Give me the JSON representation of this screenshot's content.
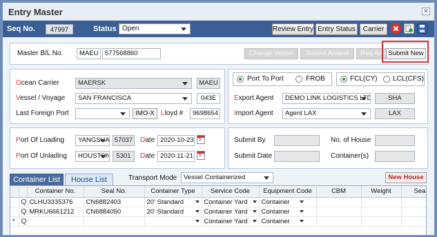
{
  "window": {
    "title": "Entry Master",
    "close_glyph": "✕"
  },
  "toolbar": {
    "seq_label": "Seq No.",
    "seq_value": "47997",
    "status_label": "Status",
    "status_value": "Open",
    "review_entry": "Review Entry",
    "entry_status": "Entry Status",
    "carrier": "Carrier"
  },
  "header": {
    "mbl_label": "Master B/L No.",
    "mbl_prefix": "MAEU",
    "mbl_value": "577568860",
    "change_vessel": "Change Vessel",
    "submit_amend": "Submit Amend",
    "req_amend": "Req Amend",
    "submit_new": "Submit New"
  },
  "carrier_section": {
    "ocean_carrier_hk": "O",
    "ocean_carrier_label": "cean Carrier",
    "ocean_carrier_value": "MAERSK",
    "ocean_carrier_code": "MAEU",
    "vessel_hk": "V",
    "vessel_label": "essel / Voyage",
    "vessel_value": "SAN FRANCISCA",
    "voyage_value": "043E",
    "last_port_label": "Last Foreign Port",
    "last_port_value": "",
    "imo_button": "IMO-X",
    "lloyd_hk": "L",
    "lloyd_label": "loyd #",
    "lloyd_value": "9698654"
  },
  "options": {
    "port_to_port": "Port To Port",
    "frob": "FROB",
    "fcl": "FCL(CY)",
    "lcl": "LCL(CFS)"
  },
  "agents": {
    "export_hk": "E",
    "export_label": "xport Agent",
    "export_value": "DEMO LINK LOGISTICS LTD.",
    "export_code": "SHA",
    "import_hk": "I",
    "import_label": "mport Agent",
    "import_value": "Agent LAX",
    "import_code": "LAX"
  },
  "ports": {
    "loading_hk": "P",
    "loading_label": "ort Of Loading",
    "loading_value": "YANGSHAN",
    "loading_code": "57037",
    "unlading_hk": "P",
    "unlading_label": "ort Of Unlading",
    "unlading_value": "HOUSTON",
    "unlading_code": "5301",
    "date_hk": "D",
    "date_label": "ate",
    "loading_date": "2020-10-23",
    "unlading_date": "2020-11-21",
    "cal_glyph": "5"
  },
  "submit_info": {
    "submit_by_label": "Submit By",
    "submit_by_value": "",
    "house_count_label": "No. of House",
    "house_count_value": "",
    "submit_date_label": "Submit Date",
    "submit_date_value": "",
    "containers_label": "Container(s)",
    "containers_value": ""
  },
  "tabs": {
    "container_list": "Container List",
    "house_list": "House List"
  },
  "transport": {
    "label": "Transport Mode",
    "value": "Vessel Containerized",
    "new_house": "New House"
  },
  "grid": {
    "columns": [
      "Container No.",
      "Seal No.",
      "Container Type",
      "Service Code",
      "Equipment Code",
      "CBM",
      "Weight",
      "Sea"
    ],
    "rows": [
      {
        "marker": "",
        "container": "CLHU3335376",
        "seal": "CN6882403",
        "type": "20' Standard",
        "service": "Container Yard",
        "equipment": "Container"
      },
      {
        "marker": "",
        "container": "MRKU6661212",
        "seal": "CN6884050",
        "type": "20' Standard",
        "service": "Container Yard",
        "equipment": "Container"
      },
      {
        "marker": "*",
        "container": "",
        "seal": "",
        "type": "",
        "service": "Container Yard",
        "equipment": "Container"
      }
    ],
    "search_glyph": "Q"
  },
  "colors": {
    "toolbar": "#3b5f94",
    "submit_new_border": "#e03030",
    "accent_red": "#c0392b",
    "radio_on": "#2e8b3a"
  },
  "icons": [
    "close-icon",
    "delete-icon",
    "new-document-icon",
    "save-icon",
    "calendar-icon",
    "search-icon",
    "chevron-down-icon"
  ]
}
